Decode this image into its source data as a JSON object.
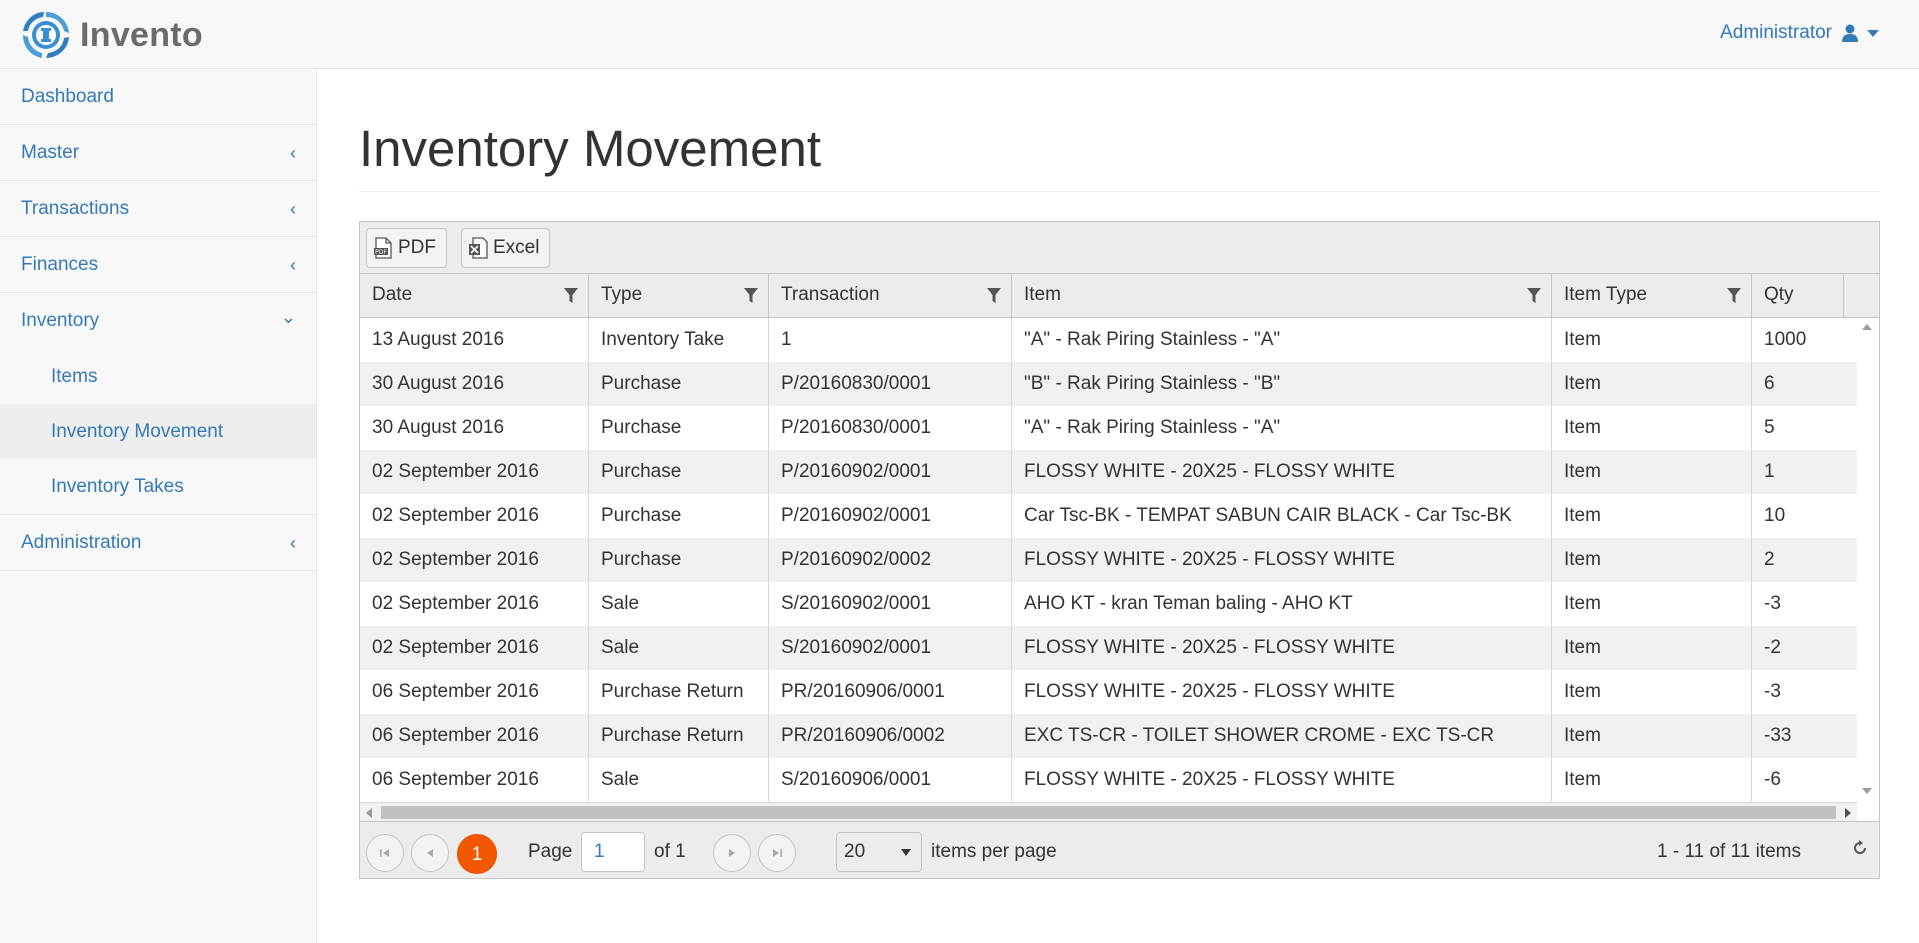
{
  "app": {
    "brand": "Invento"
  },
  "user": {
    "name": "Administrator"
  },
  "sidebar": {
    "items": [
      {
        "label": "Dashboard"
      },
      {
        "label": "Master",
        "chevron": "‹"
      },
      {
        "label": "Transactions",
        "chevron": "‹"
      },
      {
        "label": "Finances",
        "chevron": "‹"
      },
      {
        "label": "Inventory",
        "chevron": "⌄"
      }
    ],
    "inventory_sub": [
      {
        "label": "Items"
      },
      {
        "label": "Inventory Movement"
      },
      {
        "label": "Inventory Takes"
      }
    ],
    "administration": {
      "label": "Administration",
      "chevron": "‹"
    }
  },
  "page": {
    "title": "Inventory Movement"
  },
  "toolbar": {
    "pdf_label": "PDF",
    "excel_label": "Excel"
  },
  "grid": {
    "columns": [
      "Date",
      "Type",
      "Transaction",
      "Item",
      "Item Type",
      "Qty"
    ],
    "rows": [
      [
        "13 August 2016",
        "Inventory Take",
        "1",
        "\"A\" - Rak Piring Stainless - \"A\"",
        "Item",
        "1000"
      ],
      [
        "30 August 2016",
        "Purchase",
        "P/20160830/0001",
        "\"B\" - Rak Piring Stainless - \"B\"",
        "Item",
        "6"
      ],
      [
        "30 August 2016",
        "Purchase",
        "P/20160830/0001",
        "\"A\" - Rak Piring Stainless - \"A\"",
        "Item",
        "5"
      ],
      [
        "02 September 2016",
        "Purchase",
        "P/20160902/0001",
        "FLOSSY WHITE - 20X25 - FLOSSY WHITE",
        "Item",
        "1"
      ],
      [
        "02 September 2016",
        "Purchase",
        "P/20160902/0001",
        "Car Tsc-BK - TEMPAT SABUN CAIR BLACK - Car Tsc-BK",
        "Item",
        "10"
      ],
      [
        "02 September 2016",
        "Purchase",
        "P/20160902/0002",
        "FLOSSY WHITE - 20X25 - FLOSSY WHITE",
        "Item",
        "2"
      ],
      [
        "02 September 2016",
        "Sale",
        "S/20160902/0001",
        "AHO KT - kran Teman baling - AHO KT",
        "Item",
        "-3"
      ],
      [
        "02 September 2016",
        "Sale",
        "S/20160902/0001",
        "FLOSSY WHITE - 20X25 - FLOSSY WHITE",
        "Item",
        "-2"
      ],
      [
        "06 September 2016",
        "Purchase Return",
        "PR/20160906/0001",
        "FLOSSY WHITE - 20X25 - FLOSSY WHITE",
        "Item",
        "-3"
      ],
      [
        "06 September 2016",
        "Purchase Return",
        "PR/20160906/0002",
        "EXC TS-CR - TOILET SHOWER CROME - EXC TS-CR",
        "Item",
        "-33"
      ],
      [
        "06 September 2016",
        "Sale",
        "S/20160906/0001",
        "FLOSSY WHITE - 20X25 - FLOSSY WHITE",
        "Item",
        "-6"
      ]
    ]
  },
  "pager": {
    "current_page": "1",
    "page_label": "Page",
    "page_value": "1",
    "of_label": "of 1",
    "page_size": "20",
    "per_page_label": "items per page",
    "summary": "1 - 11 of 11 items"
  },
  "colors": {
    "accent": "#f35800",
    "link": "#337ab7"
  },
  "icons": [
    "logo-icon",
    "user-icon",
    "caret-down-icon",
    "chevron-left-icon",
    "chevron-down-icon",
    "pdf-icon",
    "excel-icon",
    "filter-icon",
    "first-page-icon",
    "prev-page-icon",
    "next-page-icon",
    "last-page-icon",
    "refresh-icon"
  ]
}
